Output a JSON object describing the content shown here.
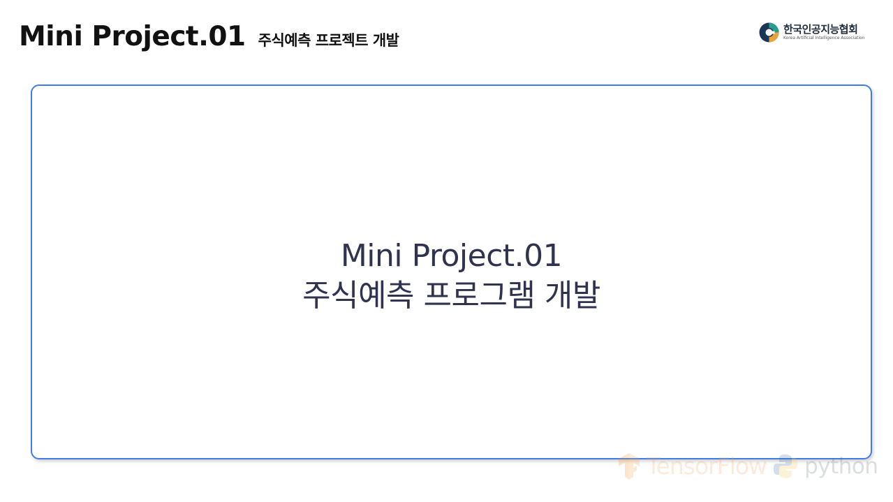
{
  "header": {
    "title": "Mini Project.01",
    "subtitle": "주식예측 프로젝트 개발"
  },
  "logo": {
    "icon": "kaia-logo-icon",
    "name_kr": "한국인공지능협회",
    "name_en": "Korea Artificial Intelligence Association"
  },
  "content": {
    "line1": "Mini Project.01",
    "line2": "주식예측 프로그램 개발"
  },
  "footer": {
    "tensorflow_label": "TensorFlow",
    "python_label": "python"
  },
  "colors": {
    "box_border": "#3f7ee0",
    "center_text": "#2f3350",
    "title_text": "#111111"
  }
}
